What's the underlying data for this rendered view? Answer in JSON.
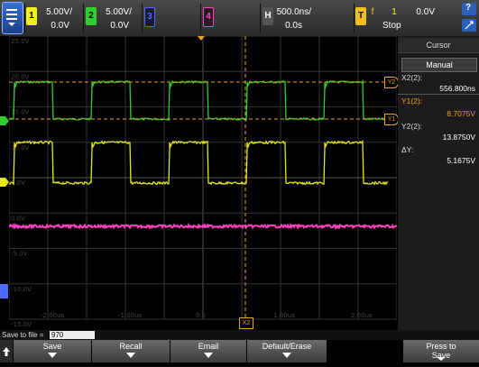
{
  "topbar": {
    "ch1": {
      "number": "1",
      "scale": "5.00V/",
      "offset": "0.0V",
      "color": "#f2f21a"
    },
    "ch2": {
      "number": "2",
      "scale": "5.00V/",
      "offset": "0.0V",
      "color": "#30d030"
    },
    "ch3": {
      "number": "3",
      "color": "#4e6cff"
    },
    "ch4": {
      "number": "4",
      "color": "#ff40c0"
    },
    "horizontal": {
      "key": "H",
      "timebase": "500.0ns/",
      "delay": "0.0s"
    },
    "trigger": {
      "key": "T",
      "mode_glyph": "f",
      "source": "1",
      "level": "0.0V",
      "status": "Stop",
      "color": "#f2c01a"
    }
  },
  "grid": {
    "y_labels": [
      "25.0V",
      "20.0V",
      "15.0V",
      "10.0V",
      "5.0V",
      "0.0V",
      "-5.0V",
      "-10.0V",
      "-15.0V"
    ],
    "x_labels": [
      "-2.00us",
      "-1.00us",
      "0.0",
      "1.00us",
      "2.00us"
    ],
    "cursor_tags": {
      "x2": "X2",
      "y1": "Y1",
      "y2": "Y2"
    }
  },
  "panel": {
    "title": "Cursor",
    "mode": "Manual",
    "x2_label": "X2(2):",
    "x2_value": "556.800ns",
    "y1_label": "Y1(2):",
    "y1_value": "8.7075V",
    "y2_label": "Y2(2):",
    "y2_value": "13.8750V",
    "dy_label": "ΔY:",
    "dy_value": "5.1675V"
  },
  "bottom": {
    "save_label": "Save to file =",
    "save_value": "970",
    "keys": [
      "Save",
      "Recall",
      "Email",
      "Default/Erase",
      "Press to\nSave"
    ]
  },
  "colors": {
    "cursor": "#f0a020",
    "grid": "#3a3a3a",
    "ch1": "#f2f21a",
    "ch2": "#30d030",
    "ch4": "#ff40c0"
  }
}
